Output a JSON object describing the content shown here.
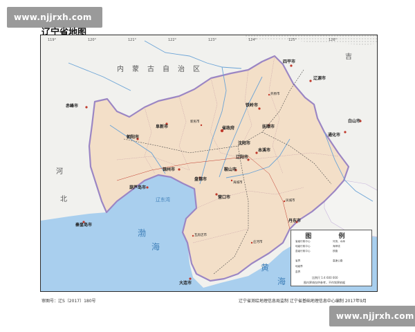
{
  "watermark_top": "www.njjrxh.com",
  "watermark_bottom": "www.njjrxh.com",
  "map_title": "辽宁省地图",
  "footer_left": "审图号：辽S〔2017〕180号",
  "footer_right": "辽宁省测绘地理信息局监制   辽宁省基础地理信息中心编制  2017年9月",
  "regions": {
    "inner_mongolia": "内蒙古自治区",
    "jilin": "吉",
    "hebei_he": "河",
    "hebei_bei": "北",
    "bohai_bo": "渤",
    "bohai_hai": "海",
    "liaodong_bay": "辽东湾",
    "yellow_sea_huang": "黄",
    "yellow_sea_hai": "海"
  },
  "cities": {
    "chifeng": "赤峰市",
    "siping": "四平市",
    "liaoyuan": "辽源市",
    "tieling": "铁岭市",
    "tonghua": "通化市",
    "baishan": "白山市",
    "fuxin": "阜新市",
    "shenyang": "沈阳市",
    "fushun": "抚顺市",
    "shenyang_gov": "省政府",
    "chaoyang": "朝阳市",
    "benxi": "本溪市",
    "liaoyang": "辽阳市",
    "jinzhou": "锦州市",
    "anshan": "鞍山市",
    "panjin": "盘锦市",
    "huludao": "葫芦岛市",
    "yingkou": "营口市",
    "dandong": "丹东市",
    "qinhuangdao": "秦皇岛市",
    "dalian": "大连市",
    "wafangdian": "瓦房店市",
    "zhuanghe": "庄河市",
    "kaiyuan": "开原市",
    "xinmin": "新民市",
    "haicheng": "海城市",
    "fengcheng": "凤城市"
  },
  "legend": {
    "title": "图 例",
    "scale": "比例尺 1:4 600 000",
    "note": "图内界线仅供参考，不作划界依据",
    "items": [
      "省级行政中心",
      "地级行政中心",
      "县级行政中心",
      "河流、水库",
      "海岸线",
      "省界",
      "地级界",
      "县界",
      "铁路",
      "高速公路"
    ]
  },
  "longitudes": [
    "119°",
    "120°",
    "121°",
    "122°",
    "123°",
    "124°",
    "125°",
    "126°"
  ],
  "colors": {
    "liaoning_land": "#f3dfc8",
    "neighbor_land": "#f1f1ee",
    "sea": "#a9cfee",
    "border_purple": "#9b86c4",
    "river": "#6aa3d6"
  }
}
